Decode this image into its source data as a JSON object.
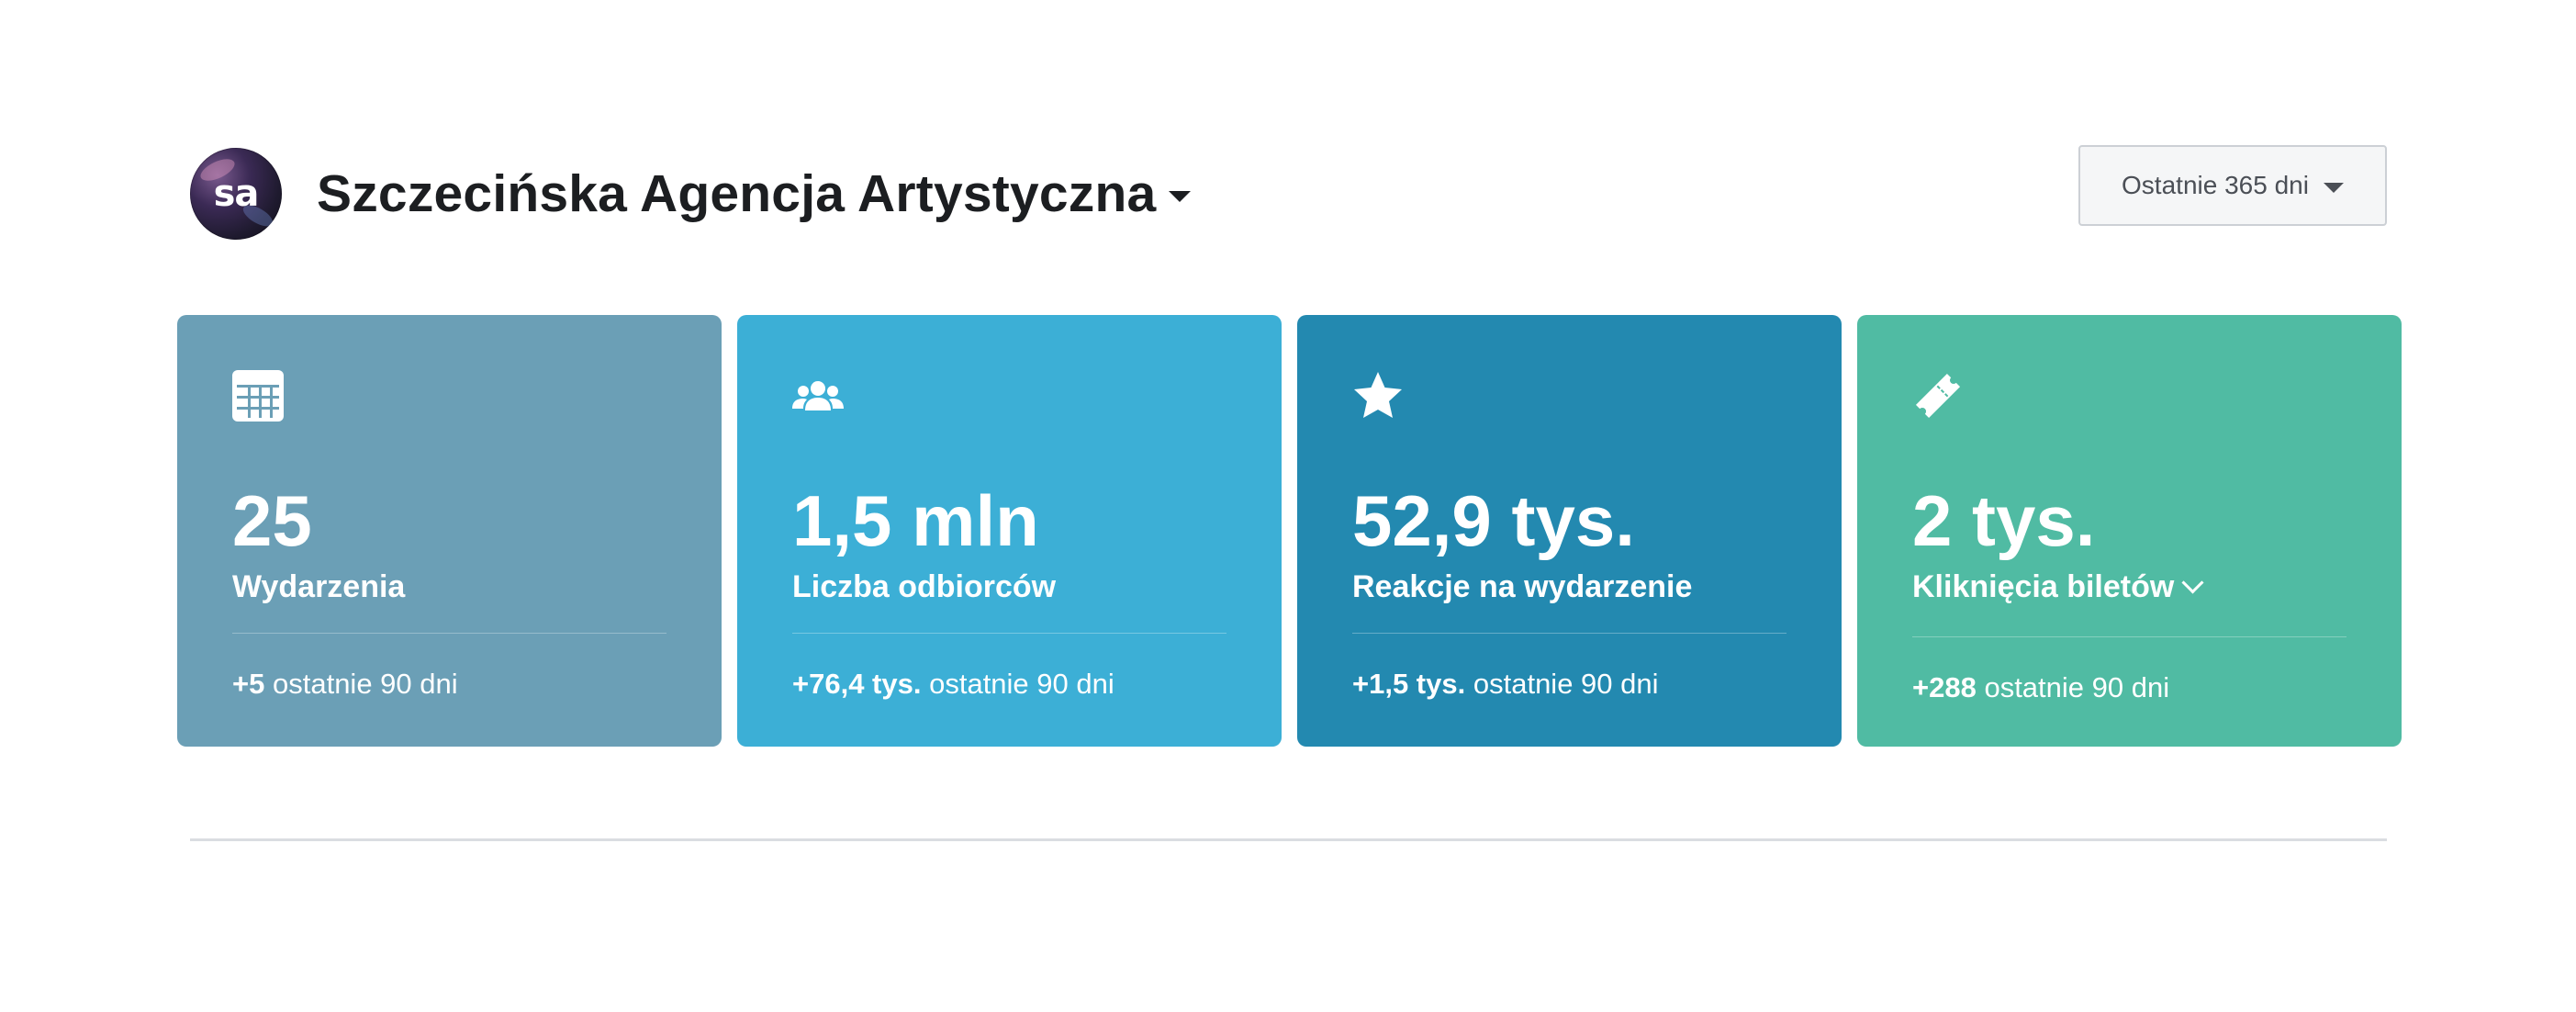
{
  "header": {
    "avatar_initials": "sa",
    "page_name": "Szczecińska Agencja Artystyczna",
    "date_range": "Ostatnie 365 dni"
  },
  "cards": [
    {
      "icon": "calendar-icon",
      "value": "25",
      "label": "Wydarzenia",
      "delta": "+5",
      "period": "ostatnie 90 dni",
      "color": "#6b9fb6"
    },
    {
      "icon": "people-icon",
      "value": "1,5 mln",
      "label": "Liczba odbiorców",
      "delta": "+76,4 tys.",
      "period": "ostatnie 90 dni",
      "color": "#3cafd6"
    },
    {
      "icon": "star-icon",
      "value": "52,9 tys.",
      "label": "Reakcje na wydarzenie",
      "delta": "+1,5 tys.",
      "period": "ostatnie 90 dni",
      "color": "#2389b0"
    },
    {
      "icon": "ticket-icon",
      "value": "2 tys.",
      "label": "Kliknięcia biletów",
      "delta": "+288",
      "period": "ostatnie 90 dni",
      "color": "#50bba3"
    }
  ]
}
